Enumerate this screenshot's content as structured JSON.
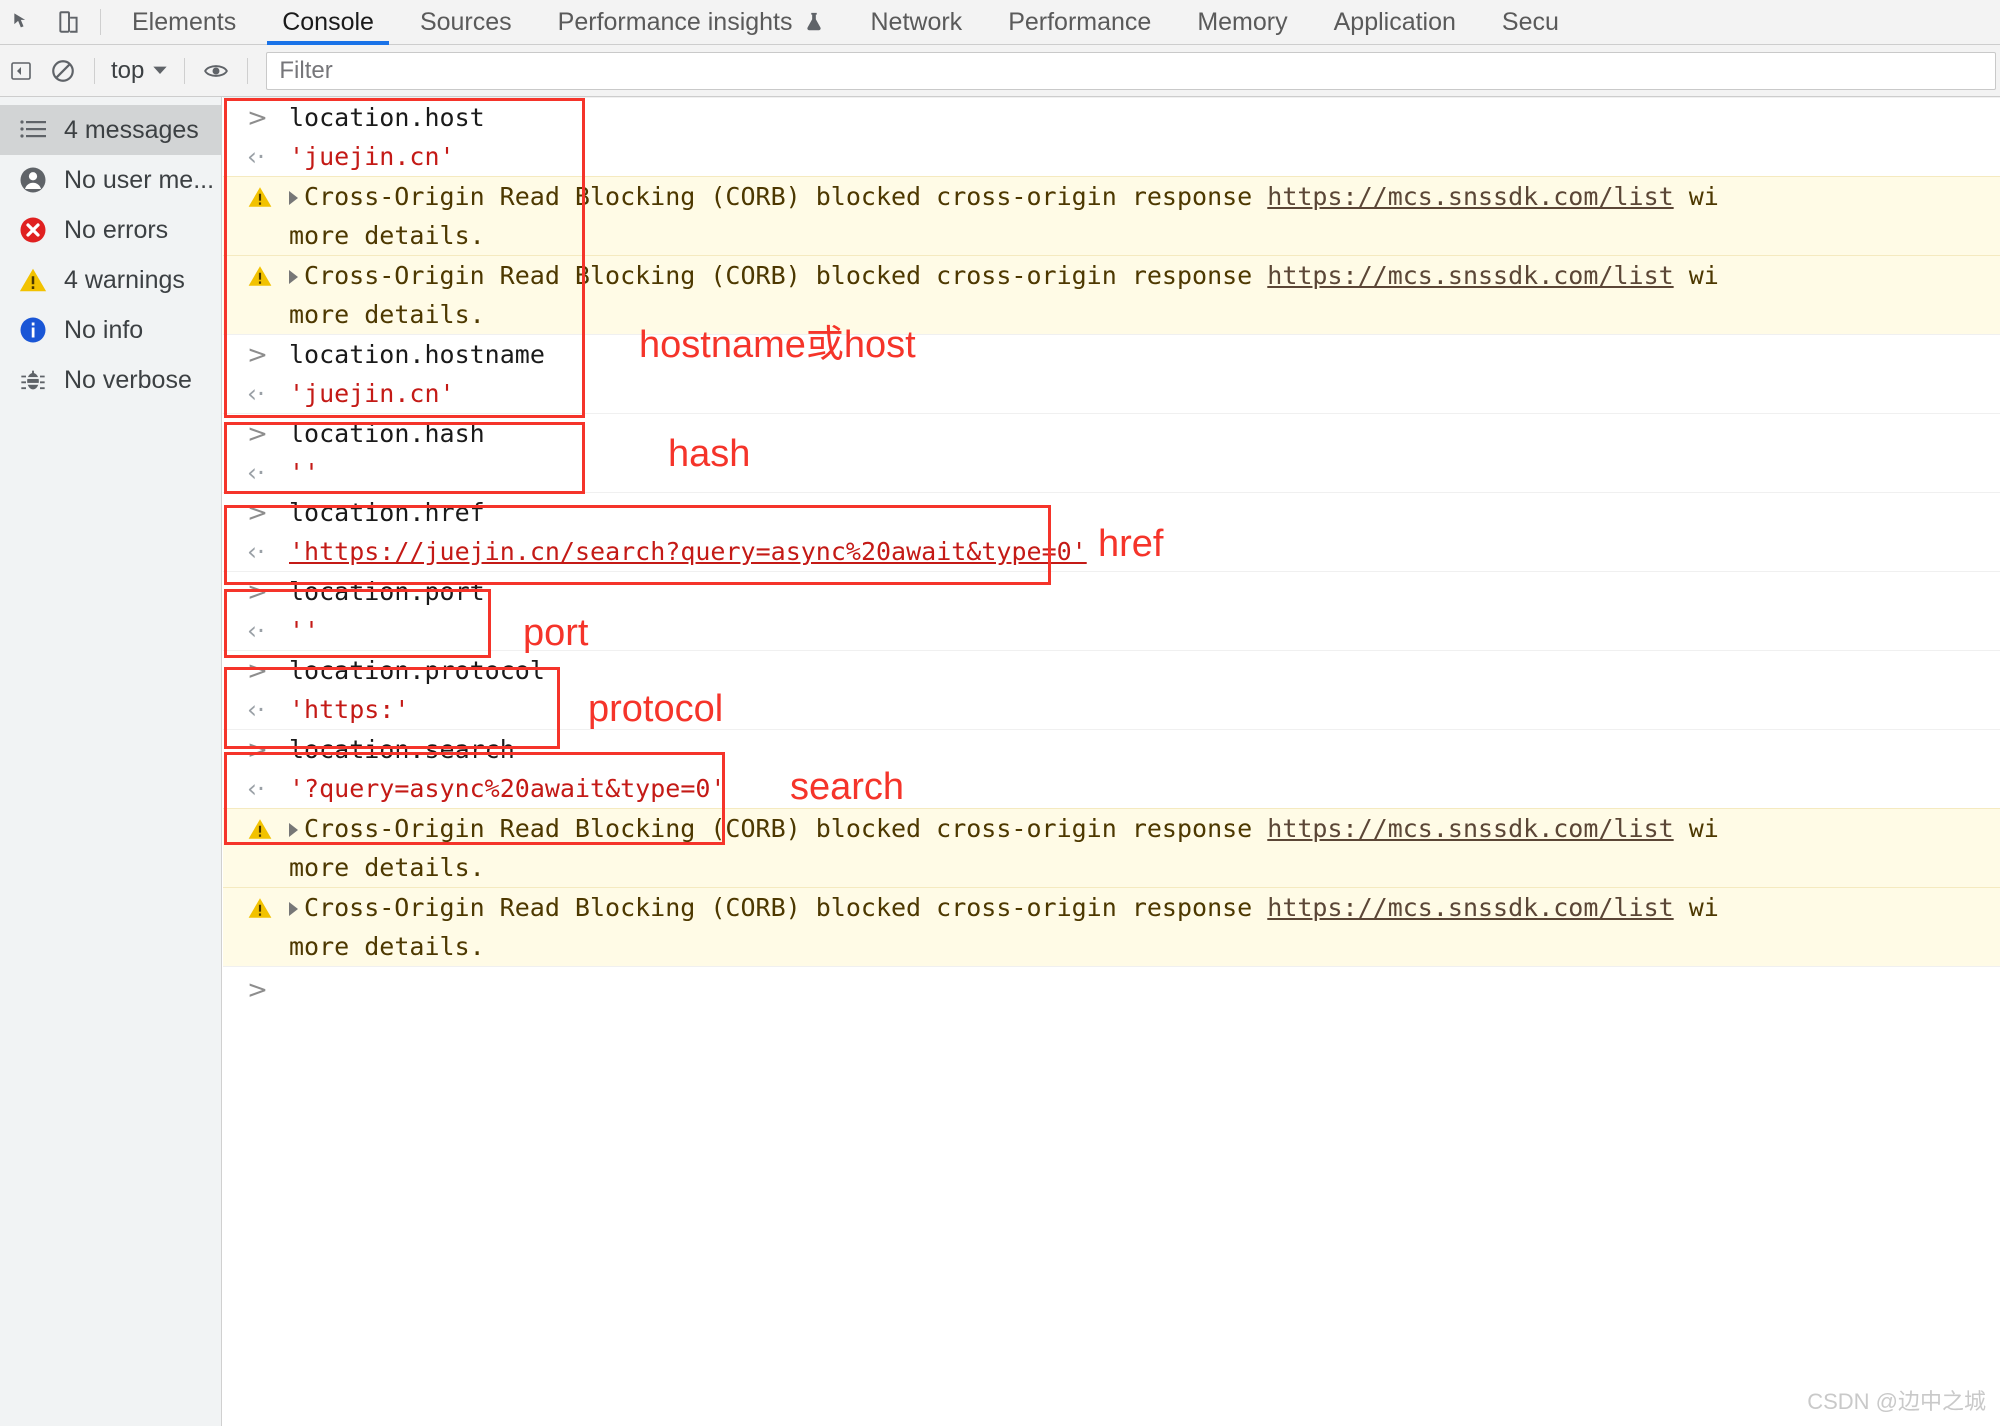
{
  "devtools": {
    "toolbar_icons": [
      "inspect-element-icon",
      "device-toolbar-icon"
    ],
    "tabs": [
      {
        "label": "Elements",
        "active": false,
        "flask": false
      },
      {
        "label": "Console",
        "active": true,
        "flask": false
      },
      {
        "label": "Sources",
        "active": false,
        "flask": false
      },
      {
        "label": "Performance insights",
        "active": false,
        "flask": true
      },
      {
        "label": "Network",
        "active": false,
        "flask": false
      },
      {
        "label": "Performance",
        "active": false,
        "flask": false
      },
      {
        "label": "Memory",
        "active": false,
        "flask": false
      },
      {
        "label": "Application",
        "active": false,
        "flask": false
      },
      {
        "label": "Secu",
        "active": false,
        "flask": false
      }
    ],
    "accent_color": "#1a73e8"
  },
  "filterbar": {
    "sidebar_toggle_icon": "show-console-sidebar-icon",
    "clear_icon": "clear-console-icon",
    "context_label": "top",
    "context_caret_icon": "chevron-down-icon",
    "eye_icon": "live-expression-icon",
    "filter_placeholder": "Filter",
    "filter_value": ""
  },
  "sidebar": {
    "items": [
      {
        "icon": "list-icon",
        "label": "4 messages",
        "selected": true
      },
      {
        "icon": "user-icon",
        "label": "No user me...",
        "selected": false
      },
      {
        "icon": "error-icon",
        "label": "No errors",
        "selected": false
      },
      {
        "icon": "warning-icon",
        "label": "4 warnings",
        "selected": false
      },
      {
        "icon": "info-icon",
        "label": "No info",
        "selected": false
      },
      {
        "icon": "bug-icon",
        "label": "No verbose",
        "selected": false
      }
    ]
  },
  "console": {
    "prompt_glyph": ">",
    "return_glyph": "‹·",
    "warning_glyph": "⚠",
    "corb_text_before_link": "Cross-Origin Read Blocking (CORB) blocked cross-origin response ",
    "corb_link": "https://mcs.snssdk.com/list",
    "corb_text_after_link": " wi",
    "corb_line2": "more details.",
    "entries": [
      {
        "type": "input",
        "text": "location.host"
      },
      {
        "type": "result",
        "text": "'juejin.cn'"
      },
      {
        "type": "warning"
      },
      {
        "type": "warning"
      },
      {
        "type": "input",
        "text": "location.hostname"
      },
      {
        "type": "result",
        "text": "'juejin.cn'"
      },
      {
        "type": "input",
        "text": "location.hash"
      },
      {
        "type": "result",
        "text": "''"
      },
      {
        "type": "input",
        "text": "location.href"
      },
      {
        "type": "result",
        "text": "'https://juejin.cn/search?query=async%20await&type=0'",
        "link": true
      },
      {
        "type": "input",
        "text": "location.port"
      },
      {
        "type": "result",
        "text": "''"
      },
      {
        "type": "input",
        "text": "location.protocol"
      },
      {
        "type": "result",
        "text": "'https:'"
      },
      {
        "type": "input",
        "text": "location.search"
      },
      {
        "type": "result",
        "text": "'?query=async%20await&type=0'"
      },
      {
        "type": "warning"
      },
      {
        "type": "warning"
      },
      {
        "type": "empty-prompt"
      }
    ]
  },
  "annotations": {
    "color": "#f5342a",
    "labels": [
      {
        "text": "hostname或host"
      },
      {
        "text": "hash"
      },
      {
        "text": "href"
      },
      {
        "text": "port"
      },
      {
        "text": "protocol"
      },
      {
        "text": "search"
      }
    ]
  },
  "watermark": {
    "text": "CSDN @边中之城"
  }
}
